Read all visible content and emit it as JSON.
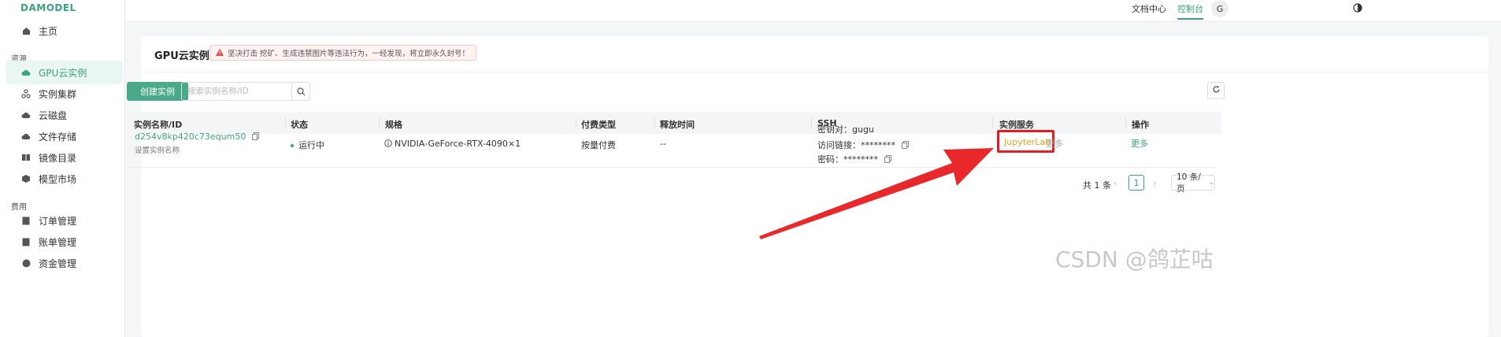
{
  "sidebar": {
    "logo": "DAMODEL",
    "home": "主页",
    "group_resources": "资源",
    "items_resources": [
      "GPU云实例",
      "实例集群",
      "云磁盘",
      "文件存储",
      "镜像目录",
      "模型市场"
    ],
    "group_billing": "费用",
    "items_billing": [
      "订单管理",
      "账单管理",
      "资金管理"
    ]
  },
  "topbar": {
    "docs": "文档中心",
    "console": "控制台",
    "avatar": "G"
  },
  "panel": {
    "title": "GPU云实例",
    "warning": "坚决打击 挖矿、生成违禁图片等违法行为，一经发现，将立即永久封号！",
    "create_label": "创建实例",
    "search_placeholder": "搜索实例名称/ID"
  },
  "table": {
    "headers": [
      "实例名称/ID",
      "状态",
      "规格",
      "付费类型",
      "释放时间",
      "SSH",
      "实例服务",
      "操作"
    ],
    "row": {
      "id": "d254v8kp420c73equm50",
      "set_name": "设置实例名称",
      "status": "运行中",
      "spec": "NVIDIA-GeForce-RTX-4090×1",
      "billing": "按量付费",
      "release": "--",
      "ssh_key": "密钥对：gugu",
      "ssh_link": "访问链接：********",
      "ssh_pwd": "密码：********",
      "service": "JupyterLab",
      "service_more": "更多",
      "action": "更多"
    }
  },
  "pagination": {
    "total": "共 1 条",
    "page": "1",
    "size": "10 条/页"
  },
  "watermark": "CSDN @鸽芷咕",
  "colors": {
    "accent": "#3aa57d",
    "highlight_box": "#e02020",
    "arrow": "#e8282b"
  }
}
